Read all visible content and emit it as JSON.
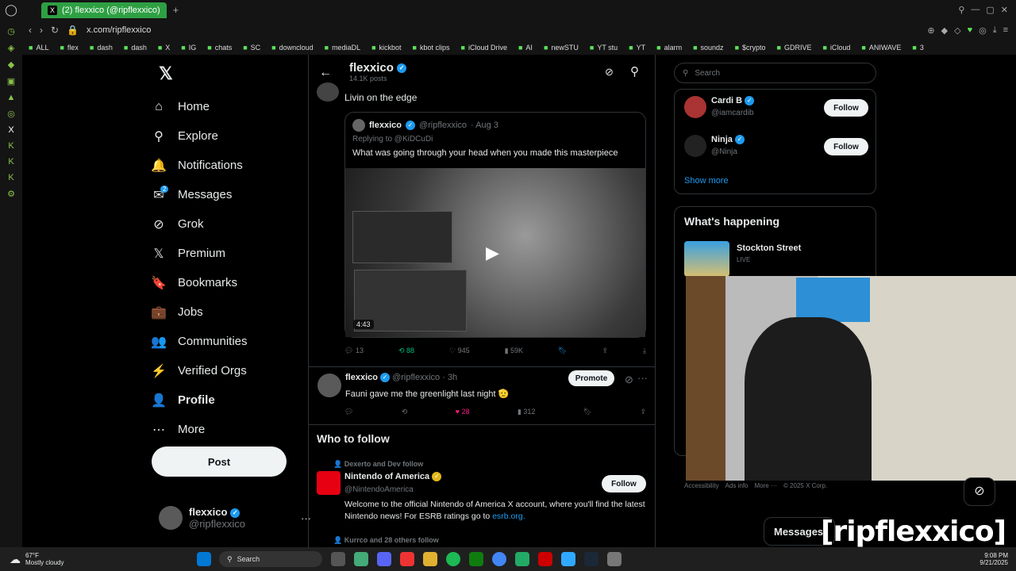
{
  "browser": {
    "tab_title": "(2) flexxico (@ripflexxico)",
    "url": "x.com/ripflexxico",
    "bookmarks": [
      "ALL",
      "flex",
      "dash",
      "dash",
      "X",
      "IG",
      "chats",
      "SC",
      "downcloud",
      "mediaDL",
      "kickbot",
      "kbot clips",
      "iCloud Drive",
      "AI",
      "newSTU",
      "YT stu",
      "YT",
      "alarm",
      "soundz",
      "$crypto",
      "GDRIVE",
      "iCloud",
      "ANIWAVE",
      "3"
    ]
  },
  "nav": {
    "items": [
      {
        "label": "Home",
        "icon": "home-icon",
        "glyph": "⌂"
      },
      {
        "label": "Explore",
        "icon": "search-icon",
        "glyph": "⚲"
      },
      {
        "label": "Notifications",
        "icon": "bell-icon",
        "glyph": "🔔"
      },
      {
        "label": "Messages",
        "icon": "mail-icon",
        "glyph": "✉"
      },
      {
        "label": "Grok",
        "icon": "grok-icon",
        "glyph": "⊘"
      },
      {
        "label": "Premium",
        "icon": "x-icon",
        "glyph": "𝕏"
      },
      {
        "label": "Bookmarks",
        "icon": "bookmark-icon",
        "glyph": "🔖"
      },
      {
        "label": "Jobs",
        "icon": "briefcase-icon",
        "glyph": "💼"
      },
      {
        "label": "Communities",
        "icon": "people-icon",
        "glyph": "👥"
      },
      {
        "label": "Verified Orgs",
        "icon": "bolt-icon",
        "glyph": "⚡"
      },
      {
        "label": "Profile",
        "icon": "person-icon",
        "glyph": "👤"
      },
      {
        "label": "More",
        "icon": "more-icon",
        "glyph": "⋯"
      }
    ],
    "messages_badge": "2",
    "post_label": "Post",
    "account_name": "flexxico",
    "account_handle": "@ripflexxico"
  },
  "profile_header": {
    "name": "flexxico",
    "posts_count": "14.1K posts"
  },
  "tweet1": {
    "text": "Livin on the edge",
    "quote": {
      "name": "flexxico",
      "handle": "@ripflexxico",
      "date": "· Aug 3",
      "replying": "Replying to @KiDCuDi",
      "text": "What was going through your head when you made this masterpiece",
      "duration": "4:43"
    },
    "replies": "13",
    "reposts": "88",
    "likes": "945",
    "views": "59K"
  },
  "tweet2": {
    "name": "flexxico",
    "handle": "@ripflexxico · 3h",
    "text": "Fauni gave me the greenlight last night 🫡",
    "promote_label": "Promote",
    "likes": "28",
    "views": "312"
  },
  "who_to_follow": {
    "title": "Who to follow",
    "context": "Dexerto and Dev follow",
    "name": "Nintendo of America",
    "handle": "@NintendoAmerica",
    "bio": "Welcome to the official Nintendo of America X account, where you'll find the latest Nintendo news! For ESRB ratings go to",
    "link": "esrb.org.",
    "follow_label": "Follow",
    "next_context": "Kurrco and 28 others follow"
  },
  "right": {
    "search_placeholder": "Search",
    "suggestions": [
      {
        "name": "Cardi B",
        "handle": "@iamcardib",
        "follow": "Follow"
      },
      {
        "name": "Ninja",
        "handle": "@Ninja",
        "follow": "Follow"
      }
    ],
    "show_more": "Show more",
    "happening_title": "What's happening",
    "trend_title": "Stockton Street",
    "trend_sub": "LIVE",
    "footer": [
      "Accessibility",
      "Ads info",
      "More ···",
      "© 2025 X Corp."
    ]
  },
  "overlay": {
    "stream_tag": "[ripflexxico]",
    "messages": "Messages"
  },
  "taskbar": {
    "temp": "67°F",
    "weather": "Mostly cloudy",
    "search": "Search",
    "time": "9:08 PM",
    "date": "9/21/2025"
  },
  "colors": {
    "accent": "#1d9bf0",
    "like_pink": "#f91880",
    "repost_green": "#00ba7c",
    "tab_green": "#2ea043"
  }
}
